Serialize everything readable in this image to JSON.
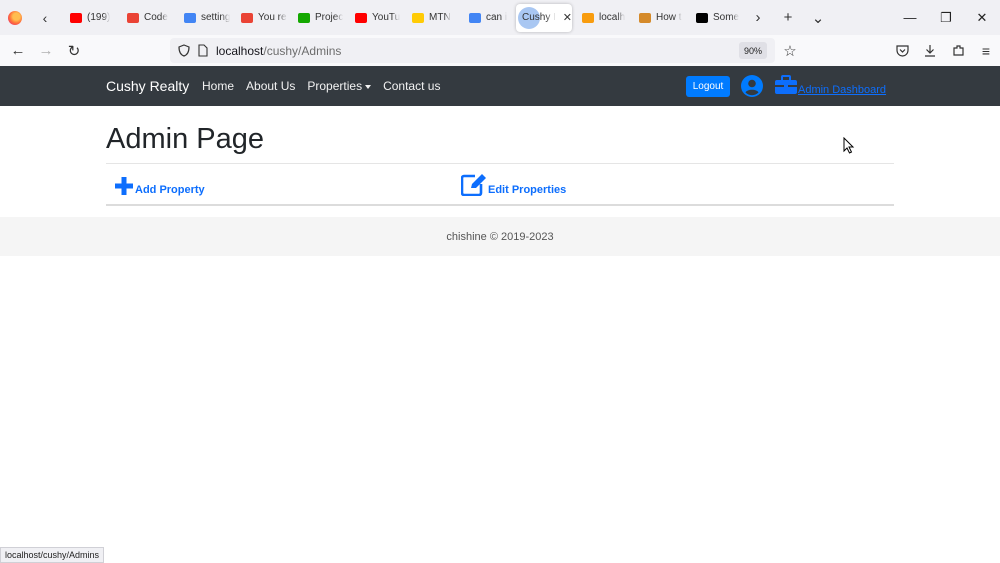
{
  "browser": {
    "tabs": [
      {
        "title": "(199)",
        "icon": "youtube-icon",
        "color": "#ff0000"
      },
      {
        "title": "Code",
        "icon": "gmail-icon",
        "color": "#ea4335"
      },
      {
        "title": "setting",
        "icon": "google-icon",
        "color": "#4285f4"
      },
      {
        "title": "You re",
        "icon": "gmail-icon",
        "color": "#ea4335"
      },
      {
        "title": "Projec",
        "icon": "upwork-icon",
        "color": "#14a800"
      },
      {
        "title": "YouTu",
        "icon": "youtube-icon",
        "color": "#ff0000"
      },
      {
        "title": "MTN",
        "icon": "mtn-icon",
        "color": "#ffcb05"
      },
      {
        "title": "can i",
        "icon": "google-icon",
        "color": "#4285f4"
      },
      {
        "title": "Cushy I",
        "icon": "loading-icon",
        "color": "#a9c7f2",
        "active": true
      },
      {
        "title": "localh",
        "icon": "phpmyadmin-icon",
        "color": "#f89c0e"
      },
      {
        "title": "How t",
        "icon": "page-icon",
        "color": "#d58a2a"
      },
      {
        "title": "Some",
        "icon": "medium-icon",
        "color": "#000000"
      }
    ],
    "url_host": "localhost",
    "url_path": "/cushy/Admins",
    "zoom": "90%",
    "status_url": "localhost/cushy/Admins"
  },
  "site": {
    "brand": "Cushy Realty",
    "nav": {
      "home": "Home",
      "about": "About Us",
      "properties": "Properties",
      "contact": "Contact us"
    },
    "logout_label": "Logout",
    "dashboard_label": "Admin Dashboard",
    "accent": "#007bff",
    "header_bg": "#343a40"
  },
  "main": {
    "title": "Admin Page",
    "add_property": "Add Property",
    "edit_properties": "Edit Properties"
  },
  "footer": {
    "text": "chishine © 2019-2023"
  }
}
